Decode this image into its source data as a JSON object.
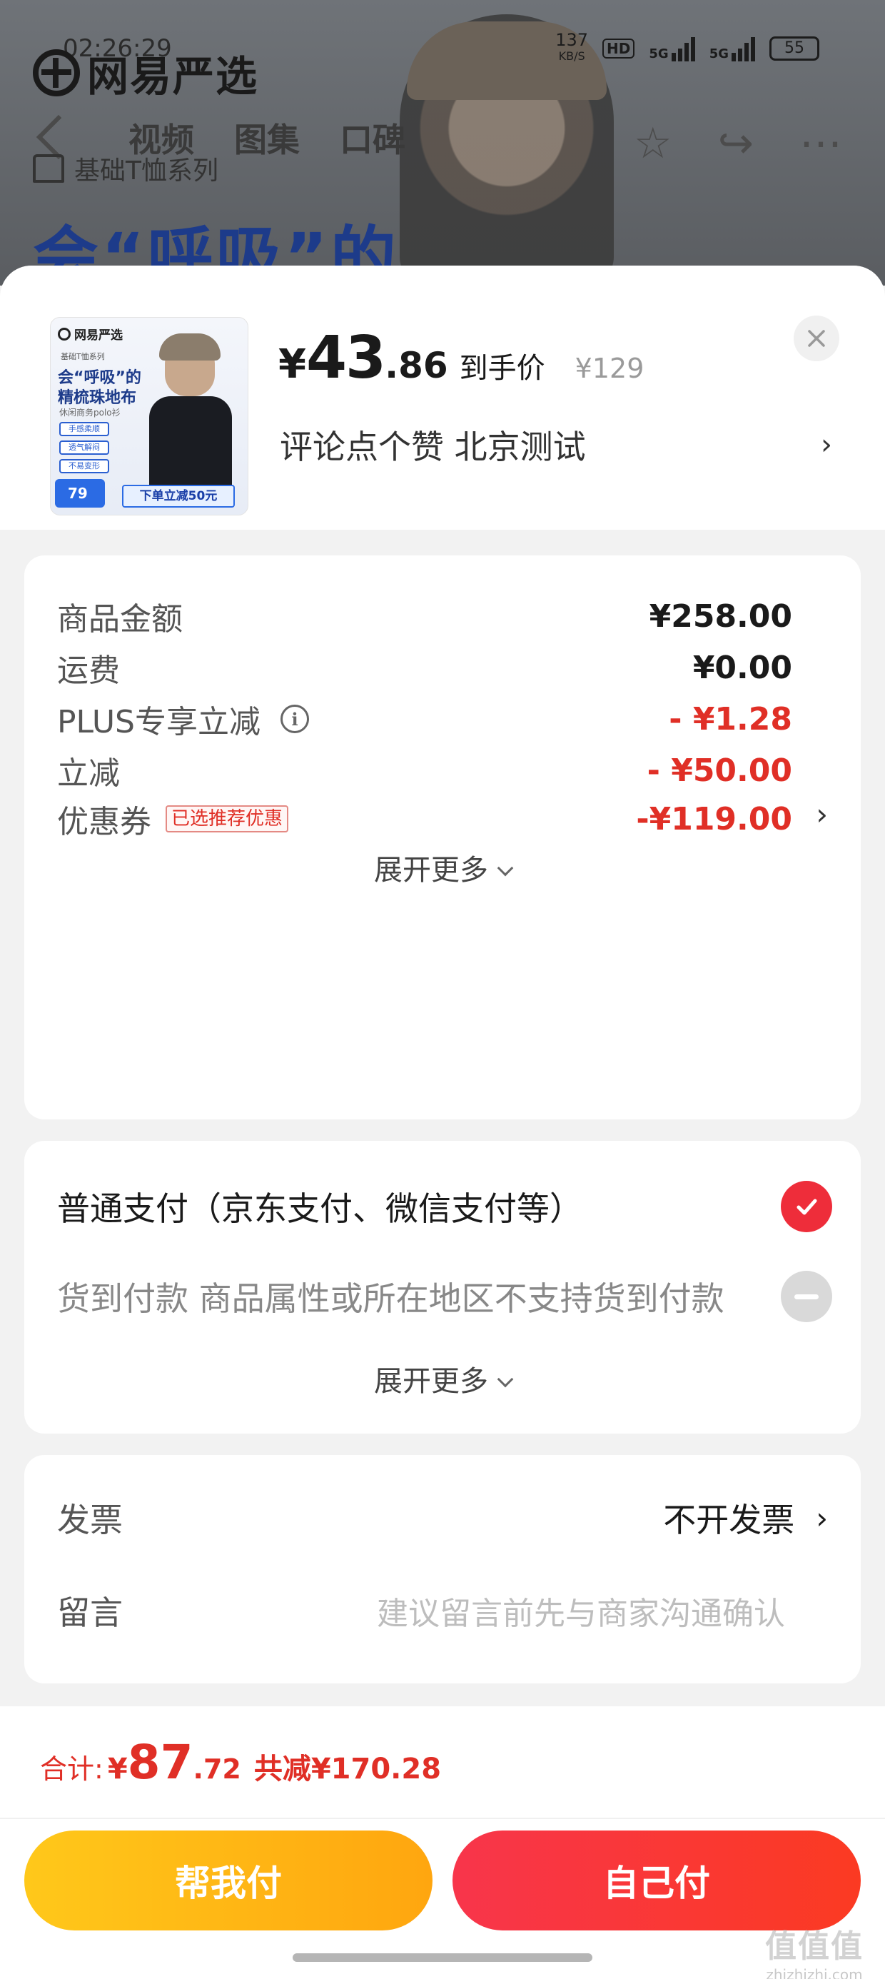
{
  "status_bar": {
    "time": "02:26:29",
    "net_speed": "137",
    "net_unit": "KB/S",
    "hd": "HD",
    "sig1": "5G",
    "sig2": "5G",
    "battery": "55"
  },
  "background": {
    "brand": "网易严选",
    "tabs": [
      "视频",
      "图集",
      "口碑"
    ],
    "series": "基础T恤系列",
    "headline": "会“呼吸”的"
  },
  "product": {
    "thumb": {
      "brand": "网易严选",
      "series": "基础T恤系列",
      "title_line1": "会“呼吸”的",
      "title_line2": "精梳珠地布",
      "subtitle": "休闲商务polo衫",
      "tags": [
        "手感柔顺",
        "透气解闷",
        "不易变形"
      ],
      "price": "79",
      "cta": "下单立减50元"
    },
    "price_yen": "¥",
    "price_int": "43",
    "price_dec": ".86",
    "price_label": "到手价",
    "original_price": "¥129",
    "spec": "评论点个赞  北京测试"
  },
  "amounts": {
    "goods_label": "商品金额",
    "goods_value": "¥258.00",
    "shipping_label": "运费",
    "shipping_value": "¥0.00",
    "plus_label": "PLUS专享立减",
    "plus_value": "- ¥1.28",
    "discount_label": "立减",
    "discount_value": "- ¥50.00",
    "coupon_label": "优惠券",
    "coupon_tag": "已选推荐优惠",
    "coupon_value": "-¥119.00",
    "expand": "展开更多"
  },
  "payment": {
    "normal_label": "普通支付（京东支付、微信支付等）",
    "cod_label": "货到付款 商品属性或所在地区不支持货到付款",
    "expand": "展开更多"
  },
  "invoice": {
    "invoice_label": "发票",
    "invoice_value": "不开发票",
    "note_label": "留言",
    "note_placeholder": "建议留言前先与商家沟通确认"
  },
  "footer": {
    "total_label": "合计:",
    "total_yen": "¥",
    "total_int": "87",
    "total_dec": ".72",
    "saved": "共减¥170.28",
    "help_pay": "帮我付",
    "self_pay": "自己付"
  },
  "watermark": {
    "glyphs": "值值值",
    "url": "zhizhizhi.com"
  },
  "colors": {
    "accent_red": "#e02f26",
    "help_button": "#ffb414",
    "self_button": "#f8354b"
  }
}
